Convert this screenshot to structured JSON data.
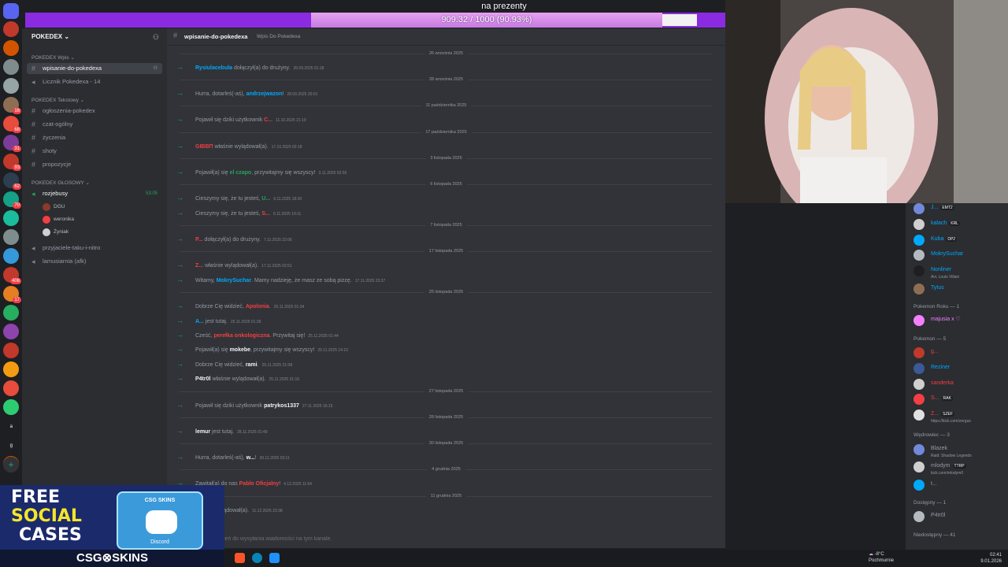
{
  "donation_goal": {
    "label": "na prezenty",
    "text": "909.32 / 1000 (90.93%)",
    "progress": 0.9093
  },
  "server": {
    "name": "POKEDEX ⌄"
  },
  "rail_badges": [
    "",
    "",
    "",
    "",
    "16",
    "68",
    "31",
    "93",
    "62",
    "70",
    "",
    "",
    "",
    "406",
    "17",
    "",
    "",
    "",
    "",
    "",
    "",
    "a",
    "g",
    ""
  ],
  "categories": {
    "wpis": "POKEDEX Wpis ⌄",
    "tekstowy": "POKEDEX Tekstowy ⌄",
    "glosowy": "POKEDEX GŁOSOWY ⌄"
  },
  "channels": {
    "wpisanie": "wpisanie-do-pokedexa",
    "licznik": "Licznik Pokedexa - 14",
    "ogloszenia": "ogłoszenia-pokedex",
    "czat": "czat-ogólny",
    "zyczenia": "życzenia",
    "shoty": "shoty",
    "propozycje": "propozycje",
    "rozjebusy": "rozjebusy",
    "rozjebusy_time": "53:05",
    "przyjaciele": "przyjaciele-taku-i-nitro",
    "lamusiarnia": "lamusiarnia (afk)"
  },
  "voice_users": [
    "DGU",
    "weronika",
    "Żyniak"
  ],
  "topbar": {
    "title": "wpisanie-do-pokedexa",
    "topic": "Wpis Do Pokedexa"
  },
  "messages": [
    {
      "sep": "26 września 2025"
    },
    {
      "pre": "",
      "user": "Rysiulacebula",
      "post": " dołączył(a) do drużyny.",
      "ts": "26.09.2025 01:18",
      "color": "#00a8fc"
    },
    {
      "sep": "28 września 2025"
    },
    {
      "pre": "Hurra, dotarleś(-aś), ",
      "user": "andrzejwazon",
      "post": "!",
      "ts": "28.09.2025 20:01",
      "color": "#00a8fc"
    },
    {
      "sep": "11 października 2025"
    },
    {
      "pre": "Pojawił się dziki użytkownik ",
      "user": "C...",
      "post": "",
      "ts": "11.10.2025 21:19",
      "color": "#f23f43"
    },
    {
      "sep": "17 października 2025"
    },
    {
      "pre": "",
      "user": "GIBBΠ",
      "post": " właśnie wylądował(a).",
      "ts": "17.10.2025 02:18",
      "color": "#f23f43"
    },
    {
      "sep": "3 listopada 2025"
    },
    {
      "pre": "Pojawił(a) się ",
      "user": "el czapo",
      "post": ", przywitajmy się wszyscy!",
      "ts": "3.11.2025 03:56",
      "color": "#23a55a"
    },
    {
      "sep": "6 listopada 2025"
    },
    {
      "pre": "Cieszymy się, że tu jesteś, ",
      "user": "U...",
      "post": "",
      "ts": "6.11.2025 18:29",
      "color": "#23a55a"
    },
    {
      "pre": "Cieszymy się, że tu jesteś, ",
      "user": "S...",
      "post": "",
      "ts": "6.11.2025 19:11",
      "color": "#f23f43"
    },
    {
      "sep": "7 listopada 2025"
    },
    {
      "pre": "",
      "user": "P...",
      "post": " dołączył(a) do drużyny.",
      "ts": "7.11.2025 22:06",
      "color": "#f23f43"
    },
    {
      "sep": "17 listopada 2025"
    },
    {
      "pre": "",
      "user": "Z...",
      "post": " właśnie wylądował(a).",
      "ts": "17.11.2025 02:51",
      "color": "#f23f43"
    },
    {
      "pre": "Witamy, ",
      "user": "MokrySuchar",
      "post": ". Mamy nadzieję, że masz ze sobą pizzę.",
      "ts": "17.11.2025 23:37",
      "color": "#00a8fc"
    },
    {
      "sep": "25 listopada 2025"
    },
    {
      "pre": "Dobrze Cię widzieć, ",
      "user": "Apolonia",
      "post": ".",
      "ts": "25.11.2025 01:34",
      "color": "#f23f43"
    },
    {
      "pre": "",
      "user": "A...",
      "post": " jest tutaj.",
      "ts": "25.11.2025 01:39",
      "color": "#00a8fc"
    },
    {
      "pre": "Cześć, ",
      "user": "perełka onkologiczna",
      "post": ". Przywitaj się!",
      "ts": "25.11.2025 01:44",
      "color": "#f23f43"
    },
    {
      "pre": "Pojawił(a) się ",
      "user": "mokebe",
      "post": ", przywitajmy się wszyscy!",
      "ts": "25.11.2025 14:10",
      "color": "#f2f3f5"
    },
    {
      "pre": "Dobrze Cię widzieć, ",
      "user": "rami",
      "post": ".",
      "ts": "25.11.2025 21:08",
      "color": "#f2f3f5"
    },
    {
      "pre": "",
      "user": "P4tr0l",
      "post": " właśnie wylądował(a).",
      "ts": "25.11.2025 21:16",
      "color": "#f2f3f5"
    },
    {
      "sep": "27 listopada 2025"
    },
    {
      "pre": "Pojawił się dziki użytkownik ",
      "user": "patrykos1337",
      "post": "",
      "ts": "27.11.2025 16:15",
      "color": "#f2f3f5"
    },
    {
      "sep": "28 listopada 2025"
    },
    {
      "pre": "",
      "user": "lemur",
      "post": " jest tutaj.",
      "ts": "28.11.2025 01:49",
      "color": "#f2f3f5"
    },
    {
      "sep": "30 listopada 2025"
    },
    {
      "pre": "Hurra, dotarleś(-aś), ",
      "user": "w...",
      "post": "!",
      "ts": "30.11.2025 03:11",
      "color": "#f2f3f5"
    },
    {
      "sep": "4 grudnia 2025"
    },
    {
      "pre": "Zawitał(a) do nas ",
      "user": "Pablo Oficjalny",
      "post": "!",
      "ts": "4.12.2025 11:54",
      "color": "#f23f43"
    },
    {
      "sep": "11 grudnia 2025"
    },
    {
      "pre": "",
      "user": "",
      "post": "właśnie wylądował(a).",
      "ts": "11.12.2025 23:38",
      "color": "#f2f3f5"
    }
  ],
  "input": {
    "placeholder": "ień do wysyłania wiadomości na tym kanale."
  },
  "members": {
    "top": [
      {
        "name": "J...",
        "tag": "EMT2",
        "color": "#00a8fc"
      },
      {
        "name": "kalach",
        "tag": "KRL",
        "color": "#00a8fc"
      },
      {
        "name": "Kuba",
        "tag": "DP2",
        "color": "#00a8fc"
      },
      {
        "name": "MokrySuchar",
        "tag": "",
        "color": "#00a8fc"
      },
      {
        "name": "Nonliner",
        "tag": "",
        "sub": "Avi, Louis Villain",
        "color": "#00a8fc"
      },
      {
        "name": "Tytus",
        "tag": "",
        "color": "#00a8fc"
      }
    ],
    "role_pokemon_roku": "Pokemon Roku — 1",
    "pokemon_roku": [
      {
        "name": "majusia x ♡",
        "color": "#f47fff"
      }
    ],
    "role_pokemon": "Pokemon — 5",
    "pokemon": [
      {
        "name": "g...",
        "tag": "",
        "color": "#f23f43"
      },
      {
        "name": "Reziner",
        "tag": "",
        "color": "#00a8fc"
      },
      {
        "name": "sanderka",
        "tag": "",
        "color": "#f23f43"
      },
      {
        "name": "S...",
        "tag": "RAK",
        "color": "#f23f43"
      },
      {
        "name": "Z...",
        "tag": "SZEF",
        "sub": "https://kick.com/zorgus",
        "color": "#f23f43"
      }
    ],
    "role_wedrowiec": "Wędrowiec — 3",
    "wedrowiec": [
      {
        "name": "Blazek",
        "sub": "Raid: Shadow Legends",
        "tag": "",
        "color": "#949ba4"
      },
      {
        "name": "mlodym",
        "tag": "TTRP",
        "sub": "kick.com/mlodym0",
        "color": "#949ba4"
      },
      {
        "name": "t...",
        "tag": "",
        "color": "#949ba4"
      }
    ],
    "role_dostepny": "Dostępny — 1",
    "dostepny": [
      {
        "name": "P4tr0l",
        "color": "#949ba4"
      }
    ],
    "role_niedostepny": "Niedostępny — 41"
  },
  "ad": {
    "line1": "FREE",
    "line2": "SOCIAL",
    "line3": "CASES",
    "box_label": "CSG SKINS",
    "box_sub": "Discord",
    "brand": "CSG⊗SKINS"
  },
  "taskbar": {
    "weather_temp": "-8°C",
    "weather_desc": "Pochmurnie",
    "time": "02:41",
    "date": "9.01.2026"
  },
  "colors": {
    "accent": "#8a2be2",
    "online": "#23a55a",
    "mention_red": "#f23f43",
    "mention_blue": "#00a8fc"
  }
}
